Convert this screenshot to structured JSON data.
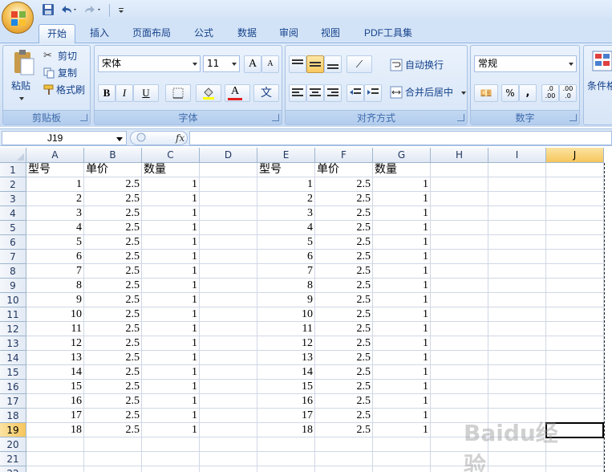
{
  "tabs": [
    "开始",
    "插入",
    "页面布局",
    "公式",
    "数据",
    "审阅",
    "视图",
    "PDF工具集"
  ],
  "ribbon": {
    "clipboard": {
      "paste": "粘贴",
      "cut": "剪切",
      "copy": "复制",
      "format_painter": "格式刷",
      "label": "剪贴板"
    },
    "font": {
      "name": "宋体",
      "size": "11",
      "grow": "A",
      "shrink": "A",
      "bold": "B",
      "italic": "I",
      "underline": "U",
      "font_color_glyph": "A",
      "phonetic": "文",
      "label": "字体"
    },
    "alignment": {
      "wrap": "自动换行",
      "merge": "合并后居中",
      "label": "对齐方式"
    },
    "number": {
      "format": "常规",
      "percent": "%",
      "comma": ",",
      "label": "数字"
    },
    "styles": {
      "cond_format": "条件格"
    }
  },
  "formula_bar": {
    "name_box": "J19",
    "fx": "fx",
    "value": ""
  },
  "columns": [
    "A",
    "B",
    "C",
    "D",
    "E",
    "F",
    "G",
    "H",
    "I",
    "J"
  ],
  "selected_cell": {
    "col": "J",
    "row": 19
  },
  "rows": [
    [
      "型号",
      "单价",
      "数量",
      "",
      "型号",
      "单价",
      "数量",
      "",
      "",
      ""
    ],
    [
      "1",
      "2.5",
      "1",
      "",
      "1",
      "2.5",
      "1",
      "",
      "",
      ""
    ],
    [
      "2",
      "2.5",
      "1",
      "",
      "2",
      "2.5",
      "1",
      "",
      "",
      ""
    ],
    [
      "3",
      "2.5",
      "1",
      "",
      "3",
      "2.5",
      "1",
      "",
      "",
      ""
    ],
    [
      "4",
      "2.5",
      "1",
      "",
      "4",
      "2.5",
      "1",
      "",
      "",
      ""
    ],
    [
      "5",
      "2.5",
      "1",
      "",
      "5",
      "2.5",
      "1",
      "",
      "",
      ""
    ],
    [
      "6",
      "2.5",
      "1",
      "",
      "6",
      "2.5",
      "1",
      "",
      "",
      ""
    ],
    [
      "7",
      "2.5",
      "1",
      "",
      "7",
      "2.5",
      "1",
      "",
      "",
      ""
    ],
    [
      "8",
      "2.5",
      "1",
      "",
      "8",
      "2.5",
      "1",
      "",
      "",
      ""
    ],
    [
      "9",
      "2.5",
      "1",
      "",
      "9",
      "2.5",
      "1",
      "",
      "",
      ""
    ],
    [
      "10",
      "2.5",
      "1",
      "",
      "10",
      "2.5",
      "1",
      "",
      "",
      ""
    ],
    [
      "11",
      "2.5",
      "1",
      "",
      "11",
      "2.5",
      "1",
      "",
      "",
      ""
    ],
    [
      "12",
      "2.5",
      "1",
      "",
      "12",
      "2.5",
      "1",
      "",
      "",
      ""
    ],
    [
      "13",
      "2.5",
      "1",
      "",
      "13",
      "2.5",
      "1",
      "",
      "",
      ""
    ],
    [
      "14",
      "2.5",
      "1",
      "",
      "14",
      "2.5",
      "1",
      "",
      "",
      ""
    ],
    [
      "15",
      "2.5",
      "1",
      "",
      "15",
      "2.5",
      "1",
      "",
      "",
      ""
    ],
    [
      "16",
      "2.5",
      "1",
      "",
      "16",
      "2.5",
      "1",
      "",
      "",
      ""
    ],
    [
      "17",
      "2.5",
      "1",
      "",
      "17",
      "2.5",
      "1",
      "",
      "",
      ""
    ],
    [
      "18",
      "2.5",
      "1",
      "",
      "18",
      "2.5",
      "1",
      "",
      "",
      ""
    ],
    [
      "",
      "",
      "",
      "",
      "",
      "",
      "",
      "",
      "",
      ""
    ],
    [
      "",
      "",
      "",
      "",
      "",
      "",
      "",
      "",
      "",
      ""
    ],
    [
      "",
      "",
      "",
      "",
      "",
      "",
      "",
      "",
      "",
      ""
    ]
  ],
  "watermark": "Baidu经验"
}
